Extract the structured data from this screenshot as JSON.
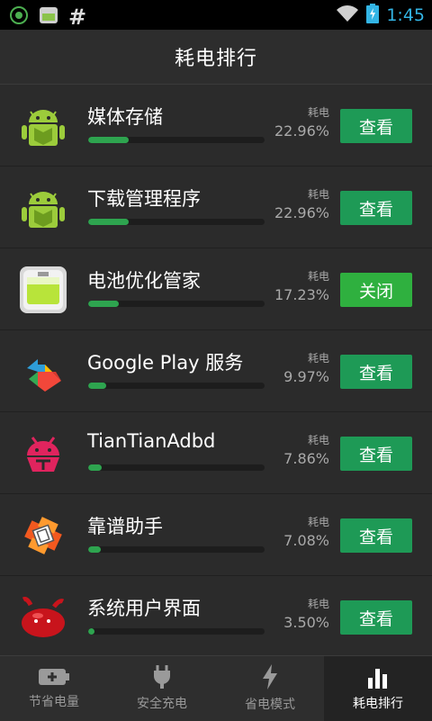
{
  "statusbar": {
    "time": "1:45",
    "hash": "#",
    "icons": [
      "android-debug-icon",
      "battery-app-icon",
      "hash-icon",
      "wifi-icon",
      "battery-charging-icon"
    ]
  },
  "header": {
    "title": "耗电排行"
  },
  "list": {
    "header_label": "耗电",
    "items": [
      {
        "name": "媒体存储",
        "percent": "22.96%",
        "usage": 0.2296,
        "action": "查看",
        "icon": "android-robot-icon"
      },
      {
        "name": "下载管理程序",
        "percent": "22.96%",
        "usage": 0.2296,
        "action": "查看",
        "icon": "android-robot-icon"
      },
      {
        "name": "电池优化管家",
        "percent": "17.23%",
        "usage": 0.1723,
        "action": "关闭",
        "icon": "battery-app-icon"
      },
      {
        "name": "Google Play 服务",
        "percent": "9.97%",
        "usage": 0.0997,
        "action": "查看",
        "icon": "google-play-services-icon"
      },
      {
        "name": "TianTianAdbd",
        "percent": "7.86%",
        "usage": 0.0786,
        "action": "查看",
        "icon": "red-bug-icon"
      },
      {
        "name": "靠谱助手",
        "percent": "7.08%",
        "usage": 0.0708,
        "action": "查看",
        "icon": "helper-app-icon"
      },
      {
        "name": "系统用户界面",
        "percent": "3.50%",
        "usage": 0.035,
        "action": "查看",
        "icon": "jelly-bean-icon"
      }
    ]
  },
  "tabs": [
    {
      "label": "节省电量",
      "icon": "battery-plus-icon",
      "active": false
    },
    {
      "label": "安全充电",
      "icon": "plug-icon",
      "active": false
    },
    {
      "label": "省电模式",
      "icon": "lightning-icon",
      "active": false
    },
    {
      "label": "耗电排行",
      "icon": "bar-chart-icon",
      "active": true
    }
  ],
  "colors": {
    "accent": "#1e9a56",
    "status_time": "#33b5e5",
    "progress": "#2ea44f"
  }
}
